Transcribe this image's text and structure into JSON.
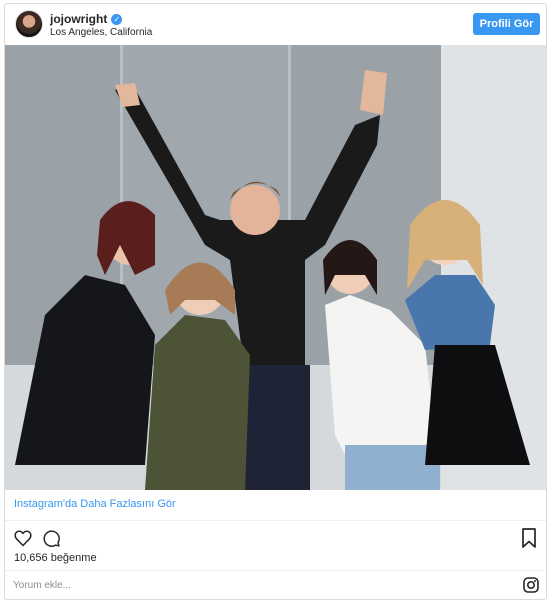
{
  "post": {
    "username": "jojowright",
    "location": "Los Angeles, California",
    "profile_button": "Profili Gör",
    "more_link": "Instagram'da Daha Fazlasını Gör",
    "likes": "10,656 beğenme",
    "comment_placeholder": "Yorum ekle..."
  },
  "icons": {
    "verified": "verified-badge-icon",
    "like": "heart-icon",
    "comment": "comment-icon",
    "save": "bookmark-icon",
    "instagram": "instagram-logo-icon"
  },
  "colors": {
    "accent": "#3897f0",
    "border": "#dbdbdb",
    "text": "#262626",
    "muted": "#8e8e8e"
  }
}
